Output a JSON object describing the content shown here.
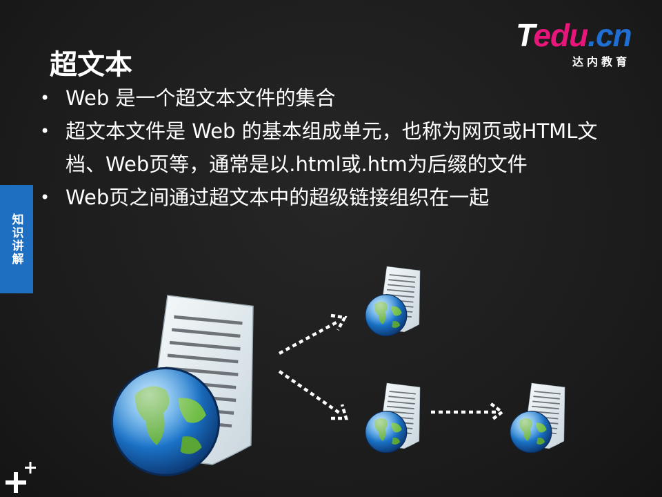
{
  "logo": {
    "brand_t": "T",
    "brand_edu": "edu",
    "brand_cn": ".cn",
    "subtitle": "达内教育"
  },
  "title": "超文本",
  "bullets": [
    "Web 是一个超文本文件的集合",
    "超文本文件是 Web 的基本组成单元，也称为网页或HTML文档、Web页等，通常是以.html或.htm为后缀的文件",
    "Web页之间通过超文本中的超级链接组织在一起"
  ],
  "bullet_marker": "•",
  "side_tab": "知识讲解",
  "icons": [
    "web-document-icon",
    "arrow-icon",
    "plus-icon"
  ],
  "colors": {
    "background": "#1e1e1e",
    "tab": "#1e6fc2",
    "brand_pink": "#e8157a",
    "brand_blue": "#1f6ed4"
  }
}
